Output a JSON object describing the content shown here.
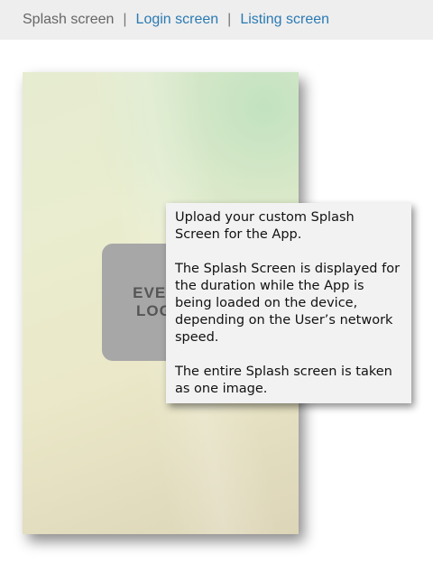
{
  "nav": {
    "tabs": [
      {
        "label": "Splash screen"
      },
      {
        "label": "Login screen"
      },
      {
        "label": "Listing screen"
      }
    ],
    "separator": "|"
  },
  "splash": {
    "logo_line1": "EVENT",
    "logo_line2": "LOGO"
  },
  "tooltip": {
    "para1": "Upload your custom Splash Screen for the App.",
    "para2": "The Splash Screen is displayed  for the duration  while the App is being loaded on the device, depending  on the User’s network speed.",
    "para3": "The entire Splash screen is taken as one image."
  },
  "colors": {
    "link": "#2a7ab3",
    "active_tab": "#666666",
    "topbar_bg": "#eeeeee",
    "tooltip_bg": "#f2f2f2",
    "logo_box": "#a7a7a7"
  }
}
